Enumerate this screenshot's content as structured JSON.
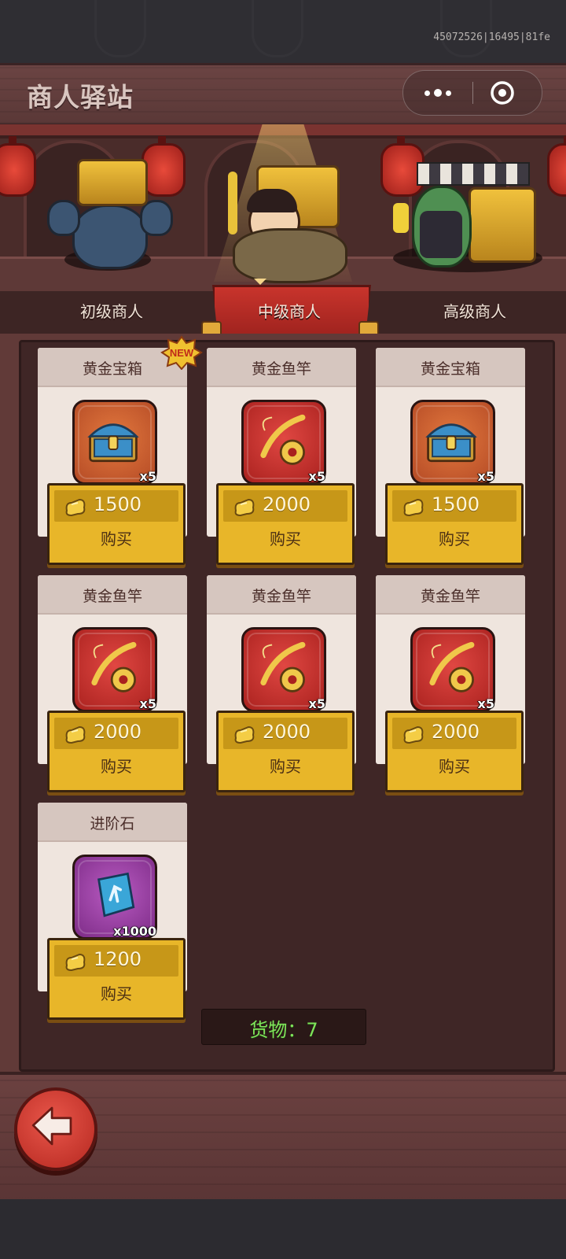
{
  "build_id": "45072526|16495|81fe",
  "header": {
    "title": "商人驿站"
  },
  "merchants": [
    {
      "label": "初级商人",
      "selected": false
    },
    {
      "label": "中级商人",
      "selected": true
    },
    {
      "label": "高级商人",
      "selected": false
    }
  ],
  "badge": {
    "new": "NEW"
  },
  "items": [
    {
      "name": "黄金宝箱",
      "qty": "x5",
      "price": "1500",
      "buy_label": "购买",
      "icon": "treasure-chest-icon",
      "frame": "orange",
      "is_new": true
    },
    {
      "name": "黄金鱼竿",
      "qty": "x5",
      "price": "2000",
      "buy_label": "购买",
      "icon": "fishing-rod-icon",
      "frame": "red",
      "is_new": false
    },
    {
      "name": "黄金宝箱",
      "qty": "x5",
      "price": "1500",
      "buy_label": "购买",
      "icon": "treasure-chest-icon",
      "frame": "orange",
      "is_new": false
    },
    {
      "name": "黄金鱼竿",
      "qty": "x5",
      "price": "2000",
      "buy_label": "购买",
      "icon": "fishing-rod-icon",
      "frame": "red",
      "is_new": false
    },
    {
      "name": "黄金鱼竿",
      "qty": "x5",
      "price": "2000",
      "buy_label": "购买",
      "icon": "fishing-rod-icon",
      "frame": "red",
      "is_new": false
    },
    {
      "name": "黄金鱼竿",
      "qty": "x5",
      "price": "2000",
      "buy_label": "购买",
      "icon": "fishing-rod-icon",
      "frame": "red",
      "is_new": false
    },
    {
      "name": "进阶石",
      "qty": "x1000",
      "price": "1200",
      "buy_label": "购买",
      "icon": "rune-stone-icon",
      "frame": "purple",
      "is_new": false
    }
  ],
  "goods": {
    "label": "货物：7"
  },
  "colors": {
    "gold": "#e8b629",
    "panel": "#3f2626",
    "goods_text": "#7fe35a"
  }
}
